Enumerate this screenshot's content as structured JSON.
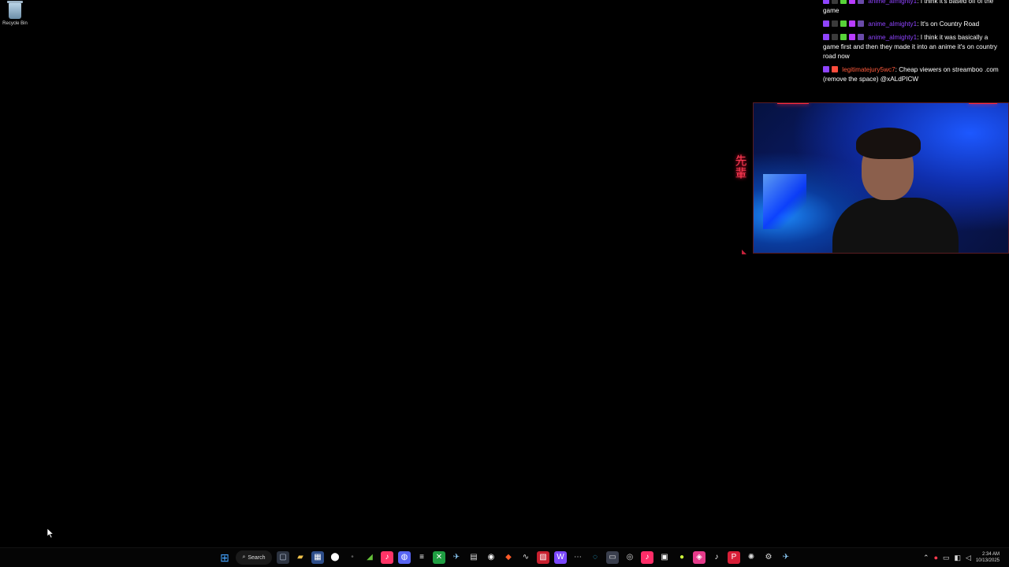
{
  "desktop": {
    "recycle_bin_label": "Recycle Bin"
  },
  "chat": {
    "messages": [
      {
        "user": "anime_almighty1",
        "text": "I think it's based off of the game",
        "user_color": "#8f44ff"
      },
      {
        "user": "anime_almighty1",
        "text": "It's on Country Road",
        "user_color": "#8f44ff"
      },
      {
        "user": "anime_almighty1",
        "text": "I think it was basically a game first and then they made it into an anime it's on country road now",
        "user_color": "#8f44ff"
      },
      {
        "user": "legitimatejury5wc7",
        "text": "Cheap viewers on streamboo .com (remove the space) @xALdPICW",
        "user_color": "#ff5a3c"
      }
    ]
  },
  "overlay": {
    "kanji_text": "先輩"
  },
  "taskbar": {
    "search_label": "Search",
    "clock_time": "2:34 AM",
    "clock_date": "10/13/2025",
    "icons": [
      {
        "name": "task-view-icon",
        "glyph": "▢",
        "color": "#b8c3d6",
        "bg": "#2d3441"
      },
      {
        "name": "file-explorer-icon",
        "glyph": "▰",
        "color": "#f1c24a",
        "bg": "transparent"
      },
      {
        "name": "calendar-icon",
        "glyph": "▦",
        "color": "#fff",
        "bg": "#2d4d89"
      },
      {
        "name": "maps-pin-icon",
        "glyph": "⬤",
        "color": "#fff",
        "bg": "transparent"
      },
      {
        "name": "hidden-app-icon",
        "glyph": "•",
        "color": "#555",
        "bg": "transparent"
      },
      {
        "name": "nvidia-icon",
        "glyph": "◢",
        "color": "#66c23a",
        "bg": "transparent"
      },
      {
        "name": "music-icon",
        "glyph": "♪",
        "color": "#fff",
        "bg": "#ff3467"
      },
      {
        "name": "discord-icon",
        "glyph": "◍",
        "color": "#fff",
        "bg": "#5865f2"
      },
      {
        "name": "app-icon",
        "glyph": "≡",
        "color": "#fff",
        "bg": "transparent"
      },
      {
        "name": "xbox-icon",
        "glyph": "✕",
        "color": "#fff",
        "bg": "#1f9e42"
      },
      {
        "name": "steam-icon",
        "glyph": "✈",
        "color": "#8fd0ff",
        "bg": "transparent"
      },
      {
        "name": "app-icon-2",
        "glyph": "▤",
        "color": "#ddd",
        "bg": "transparent"
      },
      {
        "name": "chrome-icon",
        "glyph": "◉",
        "color": "#fff",
        "bg": "transparent"
      },
      {
        "name": "brave-icon",
        "glyph": "◆",
        "color": "#ff5b29",
        "bg": "transparent"
      },
      {
        "name": "app-icon-3",
        "glyph": "∿",
        "color": "#ddd",
        "bg": "transparent"
      },
      {
        "name": "gallery-icon",
        "glyph": "▧",
        "color": "#fff",
        "bg": "#c8202f"
      },
      {
        "name": "app-icon-4",
        "glyph": "W",
        "color": "#fff",
        "bg": "#7b48ff"
      },
      {
        "name": "app-icon-5",
        "glyph": "⋯",
        "color": "#ddd",
        "bg": "transparent"
      },
      {
        "name": "edge-icon",
        "glyph": "◌",
        "color": "#2ec8ff",
        "bg": "transparent"
      },
      {
        "name": "app-icon-6",
        "glyph": "▭",
        "color": "#ddd",
        "bg": "#3a3f4d"
      },
      {
        "name": "obs-icon",
        "glyph": "◎",
        "color": "#ddd",
        "bg": "transparent"
      },
      {
        "name": "tiktok-studio-icon",
        "glyph": "♪",
        "color": "#fff",
        "bg": "#ff2d68"
      },
      {
        "name": "app-icon-7",
        "glyph": "▣",
        "color": "#fff",
        "bg": "transparent"
      },
      {
        "name": "app-icon-8",
        "glyph": "●",
        "color": "#cfff3c",
        "bg": "transparent"
      },
      {
        "name": "instagram-icon",
        "glyph": "◈",
        "color": "#fff",
        "bg": "#e63b8b"
      },
      {
        "name": "tiktok-icon",
        "glyph": "♪",
        "color": "#fff",
        "bg": "transparent"
      },
      {
        "name": "pinterest-icon",
        "glyph": "P",
        "color": "#fff",
        "bg": "#d81f38"
      },
      {
        "name": "app-icon-9",
        "glyph": "✺",
        "color": "#ddd",
        "bg": "transparent"
      },
      {
        "name": "settings-icon",
        "glyph": "⚙",
        "color": "#ddd",
        "bg": "transparent"
      },
      {
        "name": "steam-icon-2",
        "glyph": "✈",
        "color": "#8fd0ff",
        "bg": "transparent"
      }
    ]
  }
}
